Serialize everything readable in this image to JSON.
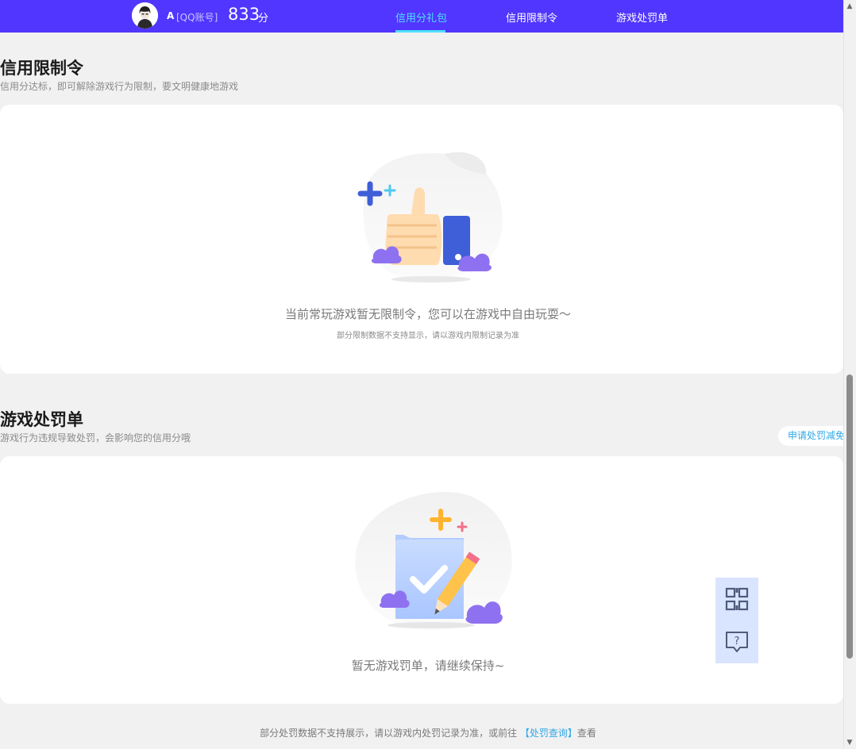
{
  "header": {
    "user_name": "A",
    "account_type": "[QQ账号]",
    "score": "833",
    "score_unit": "分",
    "tabs": [
      {
        "label": "信用分礼包",
        "active": true
      },
      {
        "label": "信用限制令",
        "active": false
      },
      {
        "label": "游戏处罚单",
        "active": false
      }
    ],
    "active_color": "#4ee0ff",
    "bar_color": "#5136ff"
  },
  "restriction": {
    "title": "信用限制令",
    "subtitle": "信用分达标，即可解除游戏行为限制，要文明健康地游戏",
    "empty_message": "当前常玩游戏暂无限制令，您可以在游戏中自由玩耍～",
    "note": "部分限制数据不支持显示，请以游戏内限制记录为准"
  },
  "penalty": {
    "title": "游戏处罚单",
    "subtitle": "游戏行为违规导致处罚，会影响您的信用分哦",
    "appeal_button": "申请处罚减免",
    "empty_message": "暂无游戏罚单，请继续保持~"
  },
  "footer": {
    "text_before": "部分处罚数据不支持展示，请以游戏内处罚记录为准，或前往",
    "link": "【处罚查询】",
    "text_after": "查看"
  },
  "floating": {
    "qr_icon": "qr-code-icon",
    "help_icon": "help-chat-icon"
  }
}
